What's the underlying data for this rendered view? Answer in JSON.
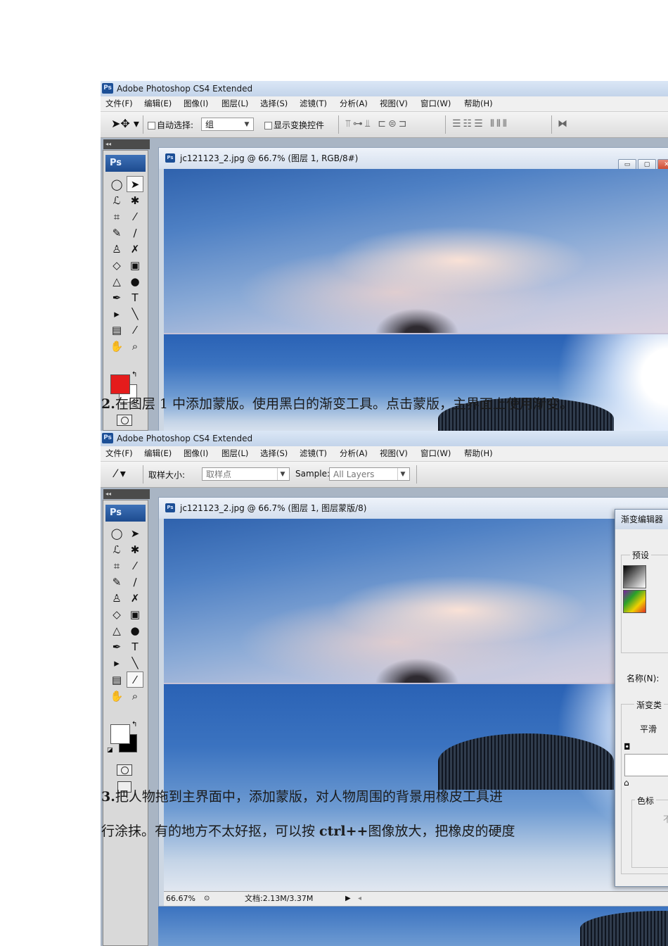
{
  "screenshot1": {
    "app_title": "Adobe Photoshop CS4 Extended",
    "menu": [
      "文件(F)",
      "编辑(E)",
      "图像(I)",
      "图层(L)",
      "选择(S)",
      "滤镜(T)",
      "分析(A)",
      "视图(V)",
      "窗口(W)",
      "帮助(H)"
    ],
    "options": {
      "auto_select_label": "自动选择:",
      "auto_select_value": "组",
      "show_transform_label": "显示变换控件"
    },
    "toolbox_logo": "Ps",
    "document_title": "jc121123_2.jpg @ 66.7% (图层 1, RGB/8#)",
    "foreground_color": "#e51c1c",
    "background_color": "#ffffff"
  },
  "screenshot2": {
    "app_title": "Adobe Photoshop CS4 Extended",
    "menu": [
      "文件(F)",
      "编辑(E)",
      "图像(I)",
      "图层(L)",
      "选择(S)",
      "滤镜(T)",
      "分析(A)",
      "视图(V)",
      "窗口(W)",
      "帮助(H)"
    ],
    "options": {
      "sample_size_label": "取样大小:",
      "sample_size_value": "取样点",
      "sample_label": "Sample:",
      "sample_value": "All Layers"
    },
    "toolbox_logo": "Ps",
    "document_title": "jc121123_2.jpg @ 66.7% (图层 1, 图层蒙版/8)",
    "foreground_color": "#ffffff",
    "background_color": "#000000",
    "status": {
      "zoom": "66.67%",
      "doc_size": "文档:2.13M/3.37M"
    },
    "gradient_editor": {
      "title": "渐变编辑器",
      "presets_label": "预设",
      "name_label": "名称(N):",
      "gradient_type_label": "渐变类",
      "smoothness_label": "平滑",
      "color_stop_label": "色标",
      "disabled_text": "不"
    }
  },
  "doc_text": {
    "step2_number": "2.",
    "step2_text": "在图层 1 中添加蒙版。使用黑白的渐变工具。点击蒙版，主界面上使用渐变。",
    "step3_number": "3.",
    "step3_line1": "把人物拖到主界面中，添加蒙版，对人物周围的背景用橡皮工具进",
    "step3_line2_pre": "行涂抹。有的地方不太好抠，可以按 ",
    "step3_line2_bold": "ctrl++",
    "step3_line2_post": "图像放大，把橡皮的硬度"
  }
}
